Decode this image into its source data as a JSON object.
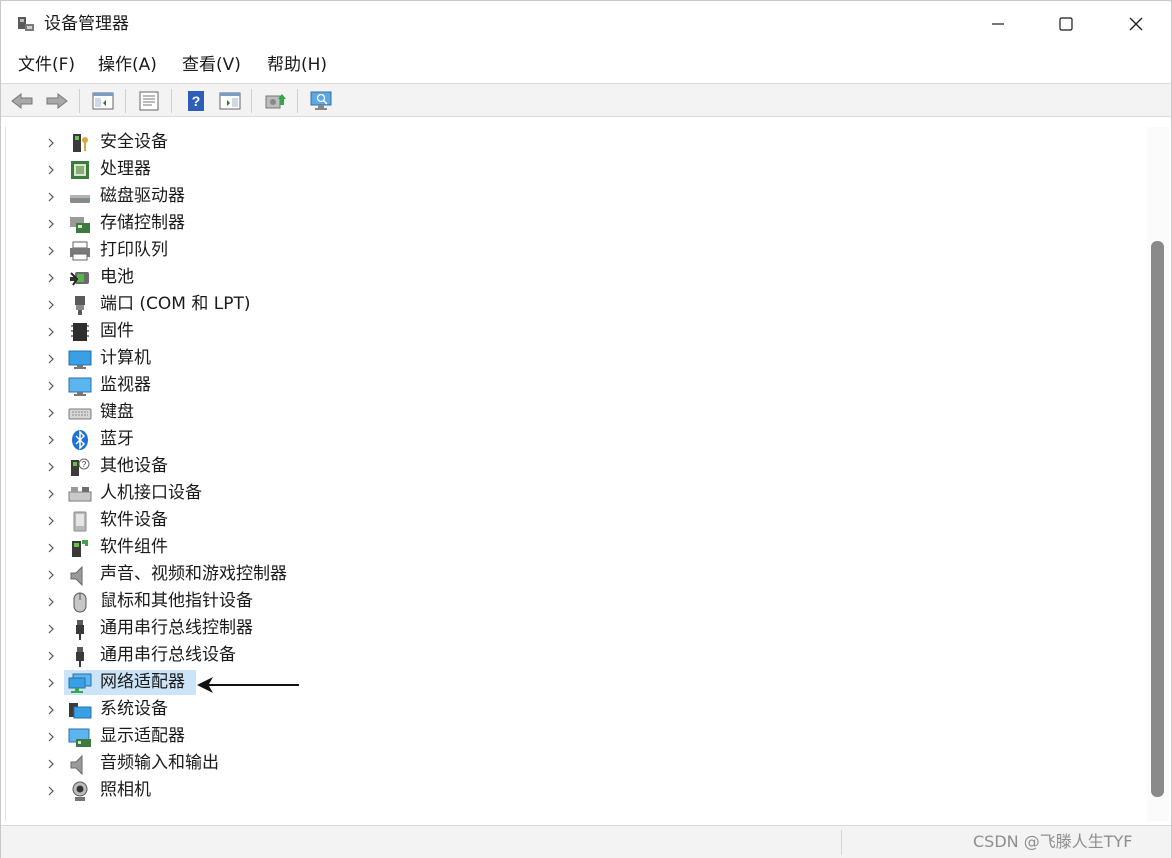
{
  "window": {
    "title": "设备管理器"
  },
  "menu": [
    "文件(F)",
    "操作(A)",
    "查看(V)",
    "帮助(H)"
  ],
  "toolbar": {
    "buttons": [
      "back-icon",
      "forward-icon",
      "show-hide-tree-icon",
      "properties-icon",
      "help-icon",
      "action-pane-icon",
      "update-driver-icon",
      "scan-hardware-icon"
    ]
  },
  "tree": {
    "items": [
      {
        "label": "安全设备",
        "icon": "security-device-icon"
      },
      {
        "label": "处理器",
        "icon": "processor-icon"
      },
      {
        "label": "磁盘驱动器",
        "icon": "disk-drive-icon"
      },
      {
        "label": "存储控制器",
        "icon": "storage-controller-icon"
      },
      {
        "label": "打印队列",
        "icon": "printer-icon"
      },
      {
        "label": "电池",
        "icon": "battery-icon"
      },
      {
        "label": "端口 (COM 和 LPT)",
        "icon": "port-icon"
      },
      {
        "label": "固件",
        "icon": "firmware-icon"
      },
      {
        "label": "计算机",
        "icon": "computer-icon"
      },
      {
        "label": "监视器",
        "icon": "monitor-icon"
      },
      {
        "label": "键盘",
        "icon": "keyboard-icon"
      },
      {
        "label": "蓝牙",
        "icon": "bluetooth-icon"
      },
      {
        "label": "其他设备",
        "icon": "other-device-icon"
      },
      {
        "label": "人机接口设备",
        "icon": "hid-icon"
      },
      {
        "label": "软件设备",
        "icon": "software-device-icon"
      },
      {
        "label": "软件组件",
        "icon": "software-component-icon"
      },
      {
        "label": "声音、视频和游戏控制器",
        "icon": "speaker-icon"
      },
      {
        "label": "鼠标和其他指针设备",
        "icon": "mouse-icon"
      },
      {
        "label": "通用串行总线控制器",
        "icon": "usb-icon"
      },
      {
        "label": "通用串行总线设备",
        "icon": "usb-device-icon"
      },
      {
        "label": "网络适配器",
        "icon": "network-adapter-icon",
        "selected": true
      },
      {
        "label": "系统设备",
        "icon": "system-device-icon"
      },
      {
        "label": "显示适配器",
        "icon": "display-adapter-icon"
      },
      {
        "label": "音频输入和输出",
        "icon": "audio-io-icon"
      },
      {
        "label": "照相机",
        "icon": "camera-icon"
      }
    ]
  },
  "status": {
    "watermark": "CSDN @飞滕人生TYF"
  },
  "colors": {
    "selection": "#cce4f7",
    "toolbar_bg": "#f3f3f3",
    "accent_blue": "#1e73d2"
  }
}
